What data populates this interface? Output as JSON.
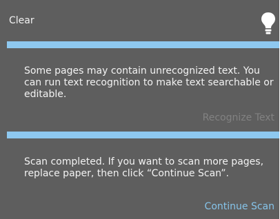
{
  "header": {
    "clear_label": "Clear",
    "icon": "lightbulb-icon"
  },
  "notices": [
    {
      "message": "Some pages may contain unrecognized text. You can run text recognition to make text searchable or editable.",
      "action_label": "Recognize Text",
      "action_state": "disabled"
    },
    {
      "message": "Scan completed. If you want to scan more pages, replace paper, then click “Continue Scan”.",
      "action_label": "Continue Scan",
      "action_state": "enabled"
    }
  ],
  "colors": {
    "panel_bg": "#5e5e5e",
    "divider": "#8ec8ef",
    "link_enabled": "#86c4ea",
    "link_disabled": "#828282"
  }
}
